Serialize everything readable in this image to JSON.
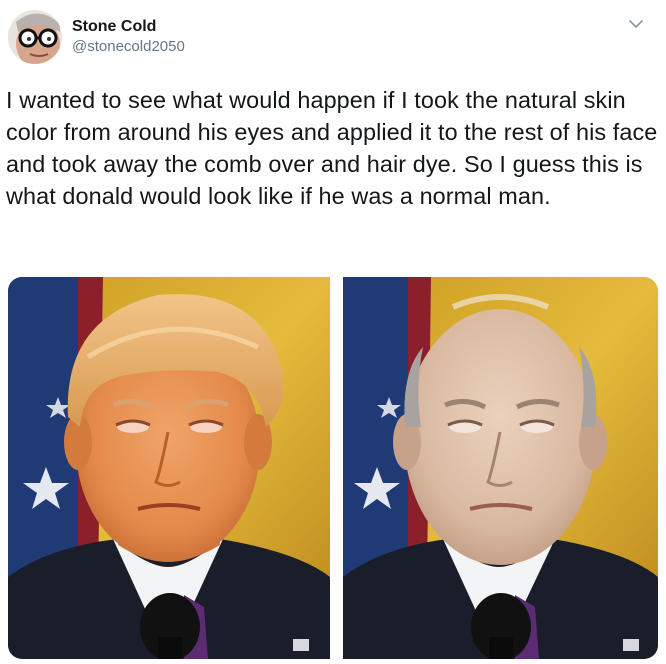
{
  "author": {
    "display_name": "Stone Cold",
    "handle": "@stonecold2050",
    "avatar_icon": "avatar-photo"
  },
  "menu": {
    "icon": "chevron-down-icon"
  },
  "tweet": {
    "text": "I wanted to see what would happen if I took the natural skin color from around his eyes and applied it to the rest of his face and took away the comb over and hair dye. So I guess this is what donald would look like if he was a normal man."
  },
  "media": {
    "images": [
      "before-photo",
      "after-photo"
    ]
  },
  "colors": {
    "text": "#14171a",
    "secondary_text": "#657786",
    "background": "#ffffff"
  }
}
